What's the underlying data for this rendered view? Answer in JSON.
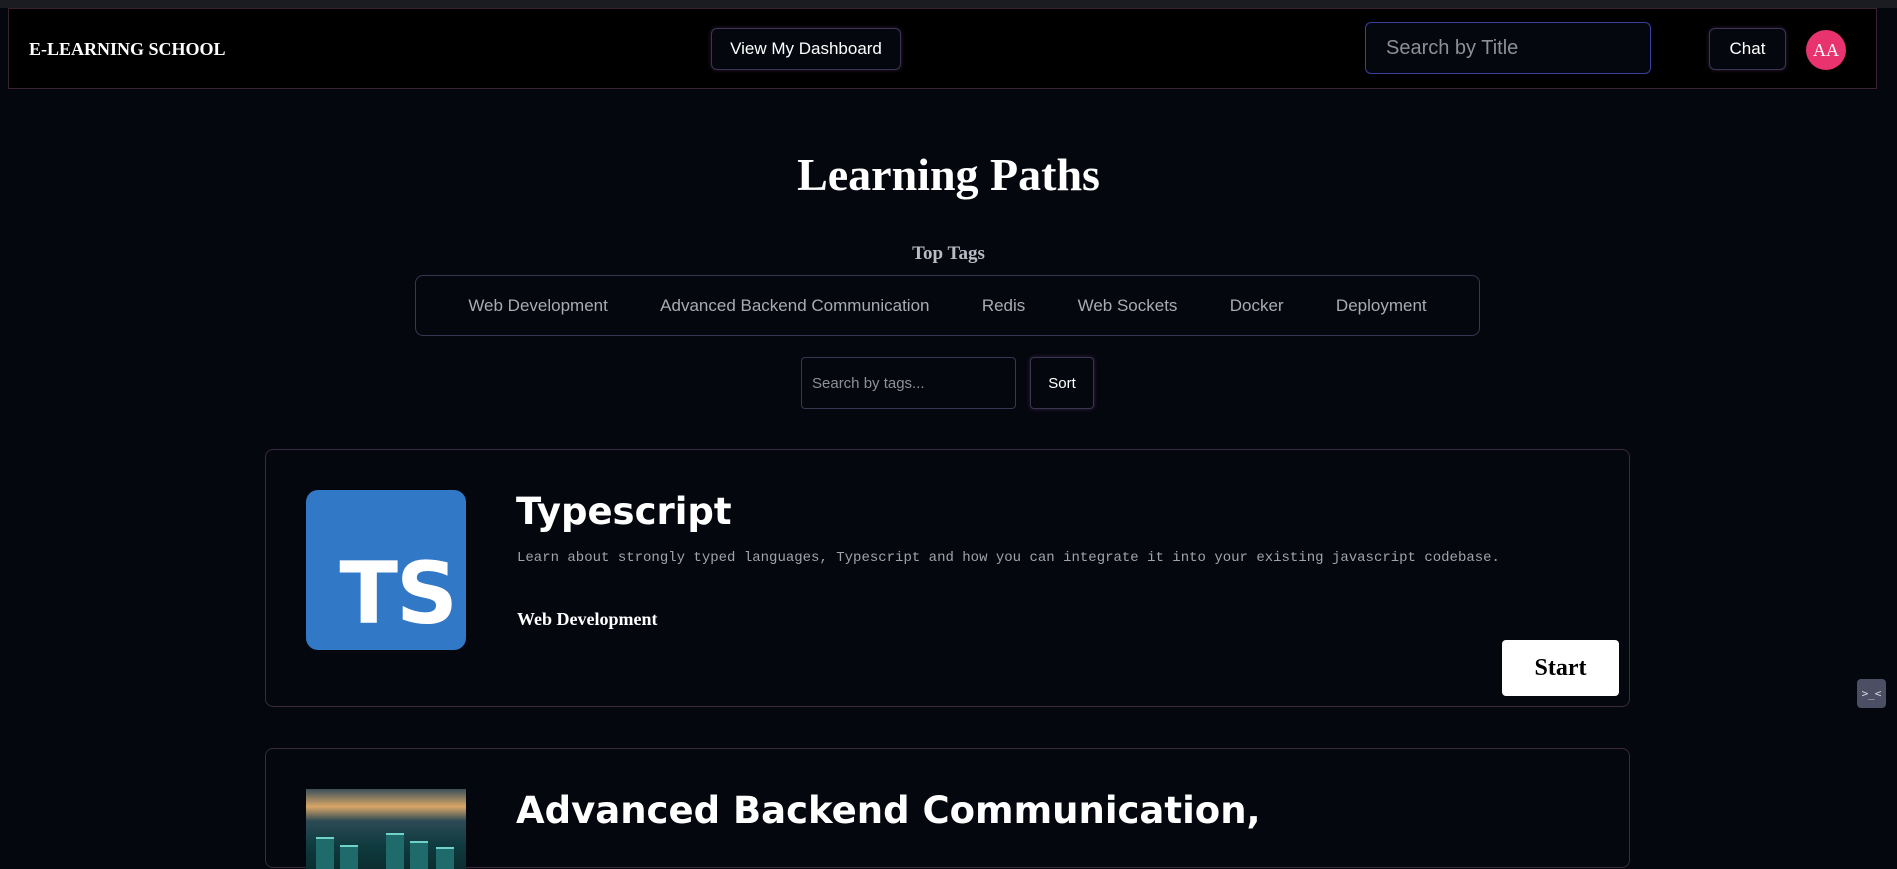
{
  "header": {
    "brand": "E-LEARNING SCHOOL",
    "dashboard_label": "View My Dashboard",
    "search_placeholder": "Search by Title",
    "chat_label": "Chat",
    "avatar_initials": "AA",
    "avatar_color": "#e8336e"
  },
  "main": {
    "title": "Learning Paths",
    "top_tags_heading": "Top Tags",
    "tags": [
      "Web Development",
      "Advanced Backend Communication",
      "Redis",
      "Web Sockets",
      "Docker",
      "Deployment"
    ],
    "tag_search_placeholder": "Search by tags...",
    "sort_label": "Sort"
  },
  "courses": [
    {
      "title": "Typescript",
      "logo_text": "TS",
      "logo_color": "#3178c6",
      "description": "Learn about strongly typed languages, Typescript and how you can integrate it into your existing javascript codebase.",
      "tag": "Web Development",
      "start_label": "Start"
    },
    {
      "title": "Advanced Backend Communication,"
    }
  ],
  "floating_widget": {
    "icon": "terminal-icon",
    "text": ">_<"
  }
}
